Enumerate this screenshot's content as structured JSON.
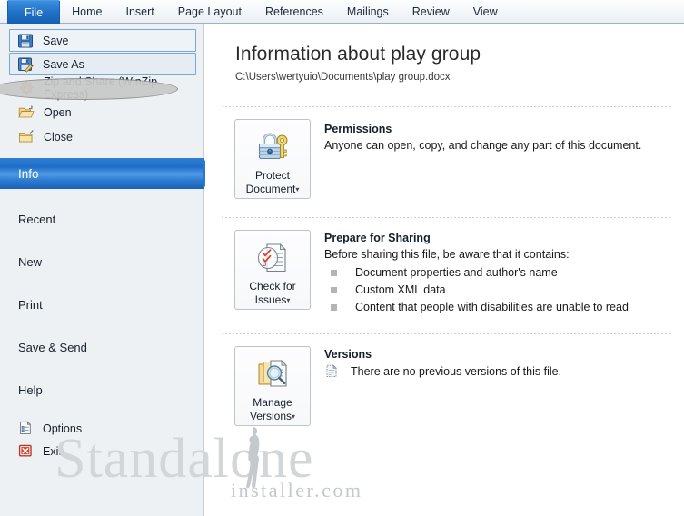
{
  "ribbon": {
    "tabs": [
      {
        "label": "File",
        "active": true
      },
      {
        "label": "Home",
        "active": false
      },
      {
        "label": "Insert",
        "active": false
      },
      {
        "label": "Page Layout",
        "active": false
      },
      {
        "label": "References",
        "active": false
      },
      {
        "label": "Mailings",
        "active": false
      },
      {
        "label": "Review",
        "active": false
      },
      {
        "label": "View",
        "active": false
      }
    ]
  },
  "sidebar": {
    "commands": [
      {
        "label": "Save",
        "icon": "floppy-disk-icon"
      },
      {
        "label": "Save As",
        "icon": "floppy-disk-pencil-icon",
        "annotated": true
      },
      {
        "label": "Zip and Share (WinZip Express)",
        "icon": "winzip-icon"
      },
      {
        "label": "Open",
        "icon": "open-folder-icon"
      },
      {
        "label": "Close",
        "icon": "close-folder-icon"
      }
    ],
    "nav": [
      {
        "label": "Info",
        "selected": true
      },
      {
        "label": "Recent",
        "selected": false
      },
      {
        "label": "New",
        "selected": false
      },
      {
        "label": "Print",
        "selected": false
      },
      {
        "label": "Save & Send",
        "selected": false
      },
      {
        "label": "Help",
        "selected": false
      }
    ],
    "footer": [
      {
        "label": "Options",
        "icon": "options-icon"
      },
      {
        "label": "Exit",
        "icon": "exit-icon"
      }
    ]
  },
  "main": {
    "title": "Information about play group",
    "path": "C:\\Users\\wertyuio\\Documents\\play group.docx",
    "sections": [
      {
        "id": "permissions",
        "button_line1": "Protect",
        "button_line2": "Document",
        "button_icon": "lock-key-icon",
        "has_caret": true,
        "heading": "Permissions",
        "description": "Anyone can open, copy, and change any part of this document."
      },
      {
        "id": "prepare-for-sharing",
        "button_line1": "Check for",
        "button_line2": "Issues",
        "button_icon": "document-check-icon",
        "has_caret": true,
        "heading": "Prepare for Sharing",
        "description": "Before sharing this file, be aware that it contains:",
        "bullets": [
          "Document properties and author's name",
          "Custom XML data",
          "Content that people with disabilities are unable to read"
        ]
      },
      {
        "id": "versions",
        "button_line1": "Manage",
        "button_line2": "Versions",
        "button_icon": "documents-search-icon",
        "has_caret": true,
        "heading": "Versions",
        "description": "There are no previous versions of this file.",
        "version_icon": "version-page-icon"
      }
    ]
  },
  "watermark": {
    "main": "Standalone",
    "sub": "installer.com"
  },
  "colors": {
    "accent": "#1f6dc6",
    "file_tab": "#1e6fc4",
    "sidebar_bg": "#edf1f4",
    "annotation": "#c8c8c8",
    "bullet": "#b4b4b4",
    "watermark": "#d2d6d9"
  }
}
